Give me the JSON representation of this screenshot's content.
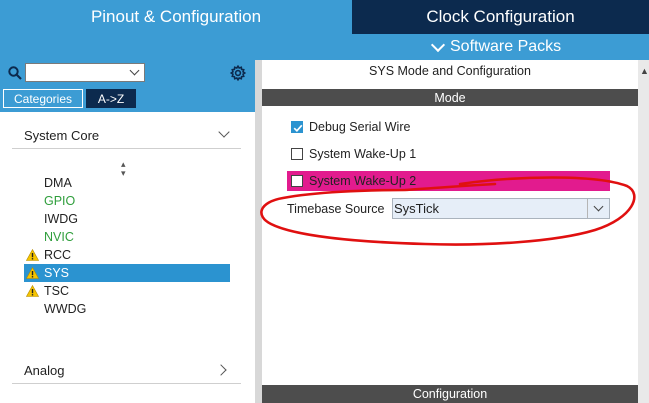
{
  "header": {
    "tab_pinout": "Pinout & Configuration",
    "tab_clock": "Clock Configuration",
    "software_packs": "Software Packs"
  },
  "left": {
    "search": {
      "value": "",
      "placeholder": ""
    },
    "tabs": {
      "categories": "Categories",
      "az": "A->Z"
    },
    "system_core": "System Core",
    "items": [
      {
        "label": "DMA",
        "color": "#222222",
        "warning": false,
        "selected": false
      },
      {
        "label": "GPIO",
        "color": "#2f9e3c",
        "warning": false,
        "selected": false
      },
      {
        "label": "IWDG",
        "color": "#222222",
        "warning": false,
        "selected": false
      },
      {
        "label": "NVIC",
        "color": "#2f9e3c",
        "warning": false,
        "selected": false
      },
      {
        "label": "RCC",
        "color": "#222222",
        "warning": true,
        "selected": false
      },
      {
        "label": "SYS",
        "color": "#ffffff",
        "warning": true,
        "selected": true
      },
      {
        "label": "TSC",
        "color": "#222222",
        "warning": true,
        "selected": false
      },
      {
        "label": "WWDG",
        "color": "#222222",
        "warning": false,
        "selected": false
      }
    ],
    "analog": "Analog"
  },
  "right": {
    "title": "SYS Mode and Configuration",
    "mode_header": "Mode",
    "options": [
      {
        "label": "Debug Serial Wire",
        "checked": true
      },
      {
        "label": "System Wake-Up 1",
        "checked": false
      },
      {
        "label": "System Wake-Up 2",
        "checked": false,
        "highlight": "#e21b8e"
      }
    ],
    "timebase_label": "Timebase Source",
    "timebase_value": "SysTick",
    "config_header": "Configuration"
  },
  "colors": {
    "primary_blue": "#3c9cd4",
    "dark_navy": "#0c2a4e",
    "selection_blue": "#2b93d0",
    "annotation_red": "#e01010",
    "warning_yellow": "#f5c400"
  },
  "icons": [
    "search-icon",
    "gear-icon",
    "warning-icon",
    "chevron-down-icon",
    "chevron-right-icon",
    "sort-icon"
  ]
}
